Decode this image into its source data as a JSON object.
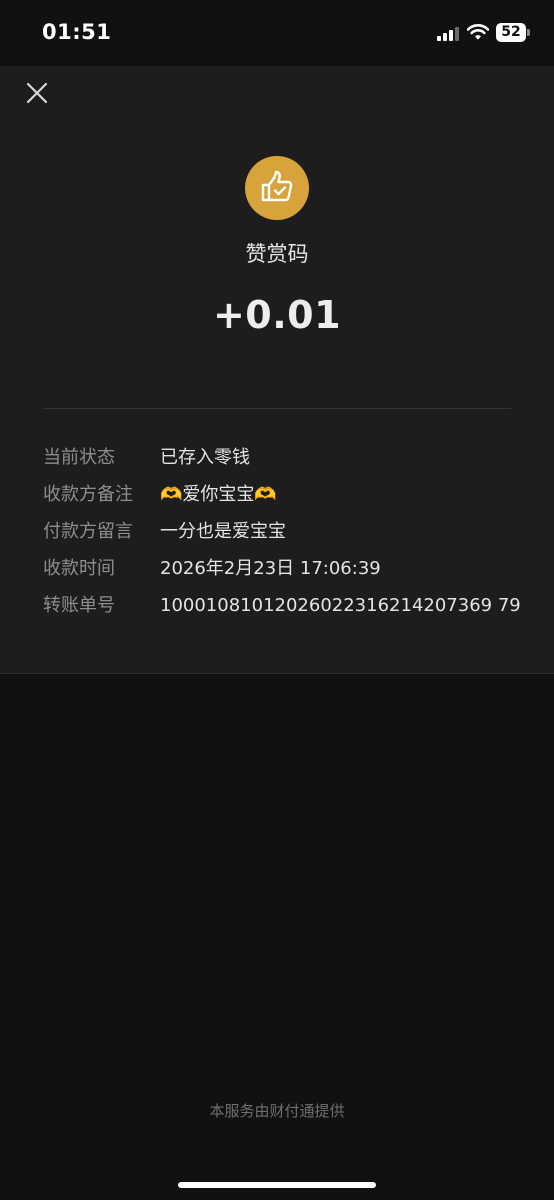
{
  "status_bar": {
    "time": "01:51",
    "battery": "52",
    "icons": [
      "signal-icon",
      "wifi-icon",
      "battery-icon"
    ]
  },
  "header": {
    "close_icon": "close-icon"
  },
  "merchant": {
    "icon": "thumbs-up-icon",
    "icon_color": "#d9a33b",
    "name": "赞赏码"
  },
  "amount": "+0.01",
  "details": [
    {
      "label": "当前状态",
      "value": "已存入零钱"
    },
    {
      "label": "收款方备注",
      "value": "🫶爱你宝宝🫶"
    },
    {
      "label": "付款方留言",
      "value": "一分也是爱宝宝"
    },
    {
      "label": "收款时间",
      "value": "2026年2月23日 17:06:39"
    },
    {
      "label": "转账单号",
      "value": "10001081012026022316214207369 79"
    }
  ],
  "footer": "本服务由财付通提供",
  "colors": {
    "background": "#111111",
    "panel": "#1d1d1d",
    "accent": "#d9a33b"
  }
}
